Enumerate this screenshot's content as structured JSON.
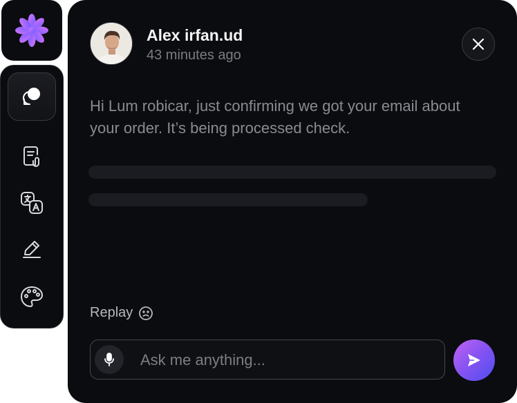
{
  "sidebar": {
    "logo_icon": "flower-icon",
    "items": [
      {
        "icon": "chat-bubble-icon",
        "active": true
      },
      {
        "icon": "document-attachment-icon"
      },
      {
        "icon": "translate-icon"
      },
      {
        "icon": "pencil-icon"
      },
      {
        "icon": "palette-icon"
      }
    ]
  },
  "message": {
    "sender_name": "Alex irfan.ud",
    "timestamp": "43 minutes ago",
    "body": "Hi Lum robicar, just confirming we got your email about your order. It’s being processed check."
  },
  "reply": {
    "label": "Replay",
    "icon": "sad-face-icon"
  },
  "composer": {
    "placeholder": "Ask me anything...",
    "mic_icon": "microphone-icon",
    "send_icon": "send-icon"
  },
  "colors": {
    "panel_bg": "#0b0c10",
    "accent_gradient_start": "#c064f5",
    "accent_gradient_end": "#4d4df0",
    "logo_start": "#d774ff",
    "logo_end": "#6a5bff"
  }
}
